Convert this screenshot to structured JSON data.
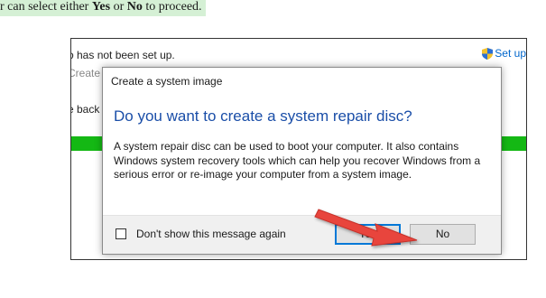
{
  "caption": {
    "prefix": "r can select either ",
    "yes": "Yes",
    "middle": " or ",
    "no": "No",
    "suffix": " to proceed."
  },
  "background": {
    "line1": "o has not been set up.",
    "line2": "Create",
    "line3": "e back",
    "setup_link": "Set up"
  },
  "dialog": {
    "title": "Create a system image",
    "heading": "Do you want to create a system repair disc?",
    "body": "A system repair disc can be used to boot your computer. It also contains Windows system recovery tools which can help you recover Windows from a serious error or re-image your computer from a system image.",
    "checkbox_label": "Don't show this message again",
    "checkbox_checked": false,
    "yes_label": "Yes",
    "no_label": "No"
  },
  "annotation": {
    "arrow_color": "#e8453c",
    "arrow_target": "no-button"
  },
  "colors": {
    "progress_green": "#14b814",
    "heading_blue": "#1a4ea8",
    "caption_highlight": "#d5f0d5"
  }
}
